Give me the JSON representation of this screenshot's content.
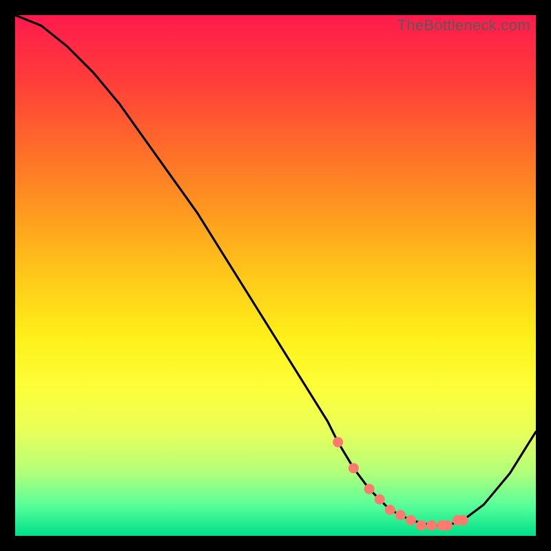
{
  "watermark": "TheBottleneck.com",
  "chart_data": {
    "type": "line",
    "title": "",
    "xlabel": "",
    "ylabel": "",
    "xlim": [
      0,
      100
    ],
    "ylim": [
      0,
      100
    ],
    "grid": false,
    "legend": false,
    "series": [
      {
        "name": "curve",
        "x": [
          0,
          5,
          10,
          15,
          20,
          25,
          30,
          35,
          40,
          45,
          50,
          55,
          60,
          62,
          65,
          68,
          72,
          76,
          80,
          83,
          86,
          90,
          95,
          100
        ],
        "y": [
          100,
          98,
          94,
          89,
          83,
          76,
          69,
          62,
          54,
          46,
          38,
          30,
          22,
          18,
          13,
          9,
          5,
          3,
          2,
          2,
          3,
          6,
          12,
          20
        ]
      }
    ],
    "markers": {
      "name": "highlight-points",
      "x": [
        62,
        65,
        68,
        70,
        72,
        74,
        76,
        78,
        80,
        82,
        83,
        85,
        86
      ],
      "y": [
        18,
        13,
        9,
        7,
        5,
        4,
        3,
        2,
        2,
        2,
        2,
        3,
        3
      ]
    },
    "colors": {
      "curve": "#000000",
      "marker": "#ff7a6e",
      "gradient_top": "#ff1a4d",
      "gradient_mid": "#fff01a",
      "gradient_bottom": "#00e08a",
      "frame": "#000000"
    }
  }
}
